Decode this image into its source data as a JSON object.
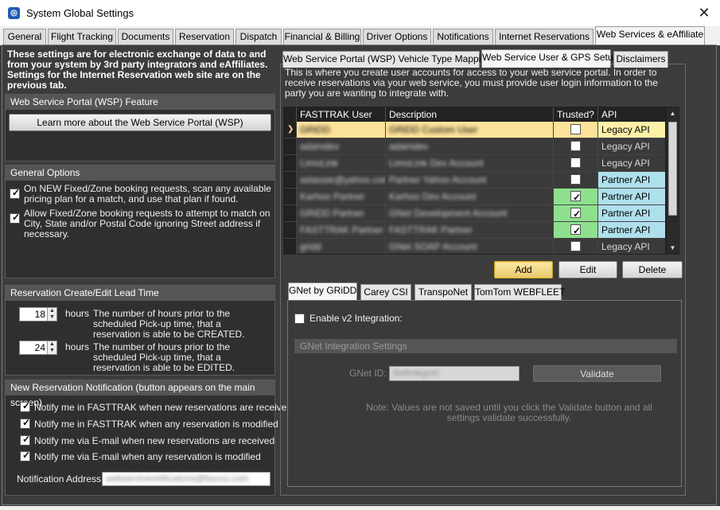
{
  "window": {
    "title": "System Global Settings",
    "close_glyph": "✕",
    "icon": "app-logo-icon"
  },
  "tabs": [
    {
      "label": "General"
    },
    {
      "label": "Flight Tracking"
    },
    {
      "label": "Documents"
    },
    {
      "label": "Reservation"
    },
    {
      "label": "Dispatch"
    },
    {
      "label": "Financial & Billing"
    },
    {
      "label": "Driver Options"
    },
    {
      "label": "Notifications"
    },
    {
      "label": "Internet Reservations"
    },
    {
      "label": "Web Services & eAffiliate",
      "active": true
    }
  ],
  "intro_text": "These settings are for electronic exchange of data to and from your system by 3rd party integrators and eAffiliates. Settings for the Internet Reservation web site are on the previous tab.",
  "wsp_feature": {
    "header": "Web Service Portal (WSP) Feature",
    "learn_more_button": "Learn more about the Web Service Portal (WSP)"
  },
  "general_options": {
    "header": "General Options",
    "options": [
      {
        "label": "On NEW Fixed/Zone booking requests, scan any available pricing plan for a match, and use that plan if found.",
        "checked": true
      },
      {
        "label": "Allow Fixed/Zone booking requests to attempt to match on City, State and/or Postal Code ignoring Street address if necessary.",
        "checked": true
      }
    ]
  },
  "lead_time": {
    "header": "Reservation Create/Edit Lead Time",
    "rows": [
      {
        "value": "18",
        "unit": "hours",
        "description": "The number of hours prior to the scheduled Pick-up time, that a reservation is able to be CREATED."
      },
      {
        "value": "24",
        "unit": "hours",
        "description": "The number of hours prior to the scheduled Pick-up time, that a reservation is able to be EDITED."
      }
    ]
  },
  "notification": {
    "header": "New Reservation Notification (button appears on the main screen)",
    "options": [
      {
        "label": "Notify me in FASTTRAK when new reservations are received",
        "checked": true
      },
      {
        "label": "Notify me in FASTTRAK when any reservation is modified",
        "checked": true
      },
      {
        "label": "Notify me via E-mail when new reservations are received",
        "checked": true
      },
      {
        "label": "Notify me via E-mail when any reservation is modified",
        "checked": true
      }
    ],
    "address_label": "Notification Address:",
    "address_value": "webservicenotifications@faxxxx.com"
  },
  "right_tabs": [
    {
      "label": "Web Service Portal (WSP) Vehicle Type Mapping"
    },
    {
      "label": "Web Service User & GPS Setup",
      "active": true
    },
    {
      "label": "Disclaimers"
    }
  ],
  "user_setup_note": "This is where you create user accounts for access to your web service portal. In order to receive reservations via your web service, you must provide user login information to the party you are wanting to integrate with.",
  "users_grid": {
    "columns": [
      "FASTTRAK User",
      "Description",
      "Trusted?",
      "API"
    ],
    "rows": [
      {
        "user": "GRiDD",
        "description": "GRiDD Custom User",
        "trusted": false,
        "api": "Legacy API",
        "selected": true
      },
      {
        "user": "adamdev",
        "description": "adamdev",
        "trusted": false,
        "api": "Legacy API"
      },
      {
        "user": "LimoLink",
        "description": "LimoLink Dev Account",
        "trusted": false,
        "api": "Legacy API"
      },
      {
        "user": "aslassie@yahoo.com",
        "description": "Partner Yahoo Account",
        "trusted": false,
        "api": "Partner API"
      },
      {
        "user": "Karhoo Partner",
        "description": "Karhoo Dev Account",
        "trusted": true,
        "api": "Partner API"
      },
      {
        "user": "GRiDD Partner",
        "description": "GNet Development Account",
        "trusted": true,
        "api": "Partner API"
      },
      {
        "user": "FASTTRAK Partner",
        "description": "FASTTRAK Partner",
        "trusted": true,
        "api": "Partner API"
      },
      {
        "user": "gridd",
        "description": "GNet SOAP Account",
        "trusted": false,
        "api": "Legacy API"
      }
    ]
  },
  "grid_buttons": {
    "add": "Add",
    "edit": "Edit",
    "delete": "Delete"
  },
  "integration_tabs": [
    {
      "label": "GNet by GRiDD",
      "active": true
    },
    {
      "label": "Carey CSI"
    },
    {
      "label": "TranspoNet"
    },
    {
      "label": "TomTom WEBFLEET"
    }
  ],
  "gnet": {
    "enable_label": "Enable v2 Integration:",
    "enabled": false,
    "settings_header": "GNet Integration Settings",
    "id_label": "GNet ID:",
    "id_value": "fasttrakgnet",
    "validate_button": "Validate",
    "note": "Note: Values are not saved until you click the Validate button and all settings validate successfully."
  },
  "colors": {
    "selected_row": "#fde29a",
    "legacy_api": "#fdf0a8",
    "partner_api": "#aee0ec",
    "trusted_green": "#8ee08e",
    "panel_bg": "#3c3c3c"
  }
}
